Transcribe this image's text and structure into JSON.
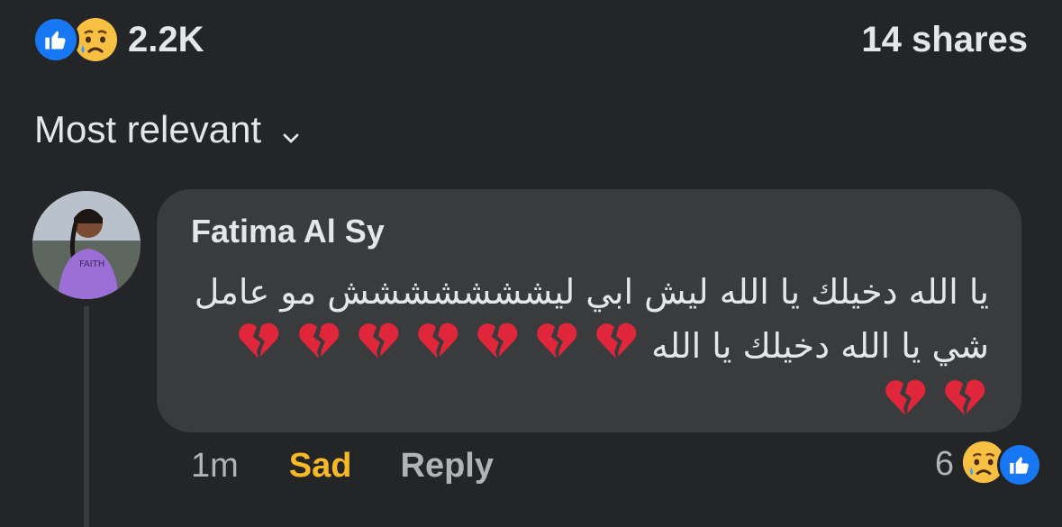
{
  "post_stats": {
    "reaction_count": "2.2K",
    "reactions": [
      "like-icon",
      "sad-icon"
    ],
    "shares": "14 shares"
  },
  "sort": {
    "label": "Most relevant",
    "icon": "chevron-down-icon"
  },
  "comment": {
    "author": "Fatima Al Sy",
    "text": "يا الله دخيلك يا الله ليش ابي ليششششششش مو عامل شي يا الله دخيلك يا الله",
    "broken_hearts": 9,
    "time": "1m",
    "reaction_label": "Sad",
    "reply_label": "Reply",
    "reaction_count": "6",
    "reaction_icons": [
      "sad-icon",
      "like-icon"
    ]
  },
  "colors": {
    "background": "#242526",
    "bubble": "#3a3b3c",
    "text": "#e4e6eb",
    "secondary_text": "#b0b3b8",
    "sad_accent": "#f7b928",
    "like_blue": "#1877f2"
  }
}
